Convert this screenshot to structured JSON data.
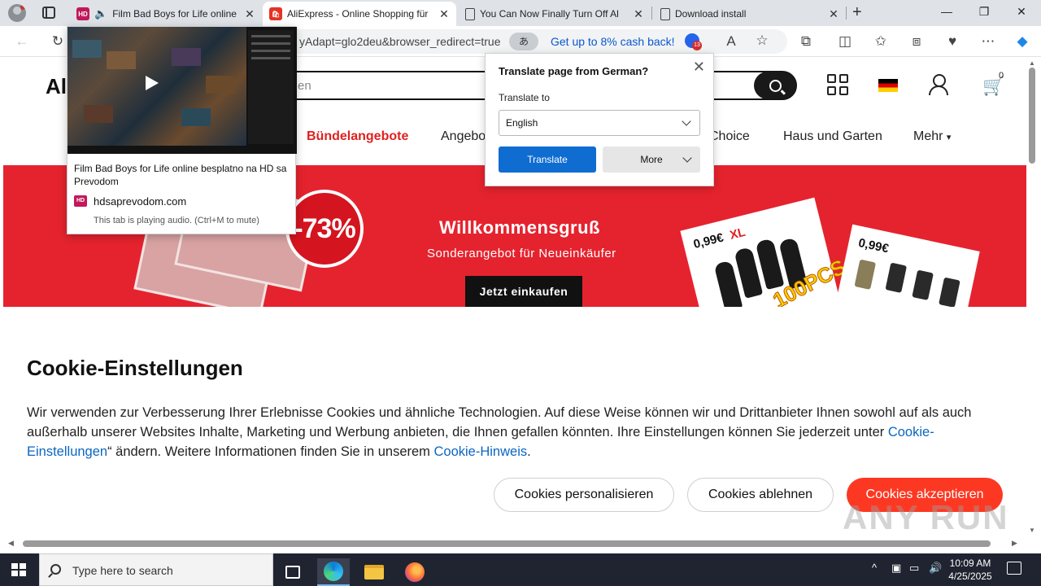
{
  "browser": {
    "tabs": [
      {
        "title": "Film Bad Boys for Life online",
        "favicon": "HD",
        "audio": true
      },
      {
        "title": "AliExpress - Online Shopping für",
        "favicon": "ali-icon"
      },
      {
        "title": "You Can Now Finally Turn Off Al",
        "favicon": "document-icon"
      },
      {
        "title": "Download install",
        "favicon": "document-icon"
      }
    ],
    "address_url": "yAdapt=glo2deu&browser_redirect=true",
    "translate_pill": "あ",
    "cashback_text": "Get up to 8% cash back!",
    "extension_badge": "13"
  },
  "hover_card": {
    "title": "Film Bad Boys for Life online besplatno na HD sa Prevodom",
    "favicon": "HD",
    "domain": "hdsaprevodom.com",
    "audio_note": "This tab is playing audio. (Ctrl+M to mute)"
  },
  "translate_popup": {
    "title": "Translate page from German?",
    "label": "Translate to",
    "selected_language": "English",
    "translate_button": "Translate",
    "more_button": "More"
  },
  "site": {
    "logo": "Al",
    "search_placeholder": "en",
    "cart_count": "0",
    "nav": [
      "Bündelangebote",
      "Angebo",
      "Choice",
      "Haus und Garten",
      "Mehr"
    ],
    "banner": {
      "discount": "-73%",
      "title": "Willkommensgruß",
      "subtitle": "Sonderangebot für Neueinkäufer",
      "cta": "Jetzt einkaufen",
      "card1_price": "0,99€",
      "card1_size": "XL",
      "card1_badge": "100PCS",
      "card2_price": "0,99€"
    }
  },
  "cookie": {
    "title": "Cookie-Einstellungen",
    "text_part1": "Wir verwenden zur Verbesserung Ihrer Erlebnisse Cookies und ähnliche Technologien. Auf diese Weise können wir und Drittanbieter Ihnen sowohl auf als auch außerhalb unserer Websites Inhalte, Marketing und Werbung anbieten, die Ihnen gefallen könnten. Ihre Einstellungen können Sie jederzeit unter ",
    "link1": "Cookie-Einstellungen",
    "text_part2": "“ ändern. Weitere Informationen finden Sie in unserem ",
    "link2": "Cookie-Hinweis",
    "text_part3": ".",
    "btn_personalize": "Cookies personalisieren",
    "btn_decline": "Cookies ablehnen",
    "btn_accept": "Cookies akzeptieren"
  },
  "taskbar": {
    "search_placeholder": "Type here to search",
    "time": "10:09 AM",
    "date": "4/25/2025"
  },
  "watermark": "ANY RUN",
  "colors": {
    "ali_red": "#e5232e",
    "accept_button": "#fd3822",
    "translate_blue": "#0f6cd0",
    "link_blue": "#0b66c2"
  }
}
